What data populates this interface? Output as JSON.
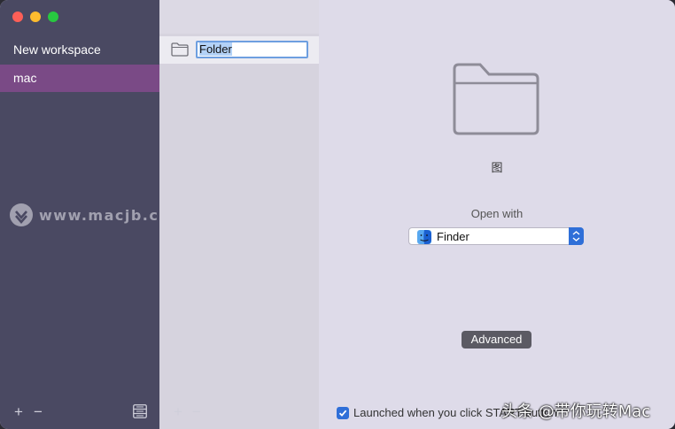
{
  "sidebar": {
    "items": [
      {
        "label": "New workspace",
        "active": false
      },
      {
        "label": "mac",
        "active": true
      }
    ],
    "add_icon": "plus-icon",
    "remove_icon": "minus-icon",
    "list_icon": "list-icon"
  },
  "middle": {
    "items": [
      {
        "name": "Folder",
        "editing": true,
        "icon": "folder-icon"
      }
    ],
    "add_icon": "plus-icon",
    "remove_icon": "minus-icon"
  },
  "detail": {
    "icon": "large-folder-icon",
    "name_label": "图",
    "open_with_label": "Open with",
    "app": {
      "name": "Finder",
      "icon": "finder-icon"
    },
    "advanced_label": "Advanced",
    "launch_checkbox": {
      "label": "Launched when you click START button",
      "checked": true
    }
  },
  "watermarks": {
    "site": "www.macjb.com",
    "social": "头条 @带你玩转Mac"
  },
  "colors": {
    "sidebar_bg": "#4a4962",
    "sidebar_active": "#7a4a86",
    "accent": "#2f6fd8",
    "advanced_button": "#5b5a63"
  }
}
